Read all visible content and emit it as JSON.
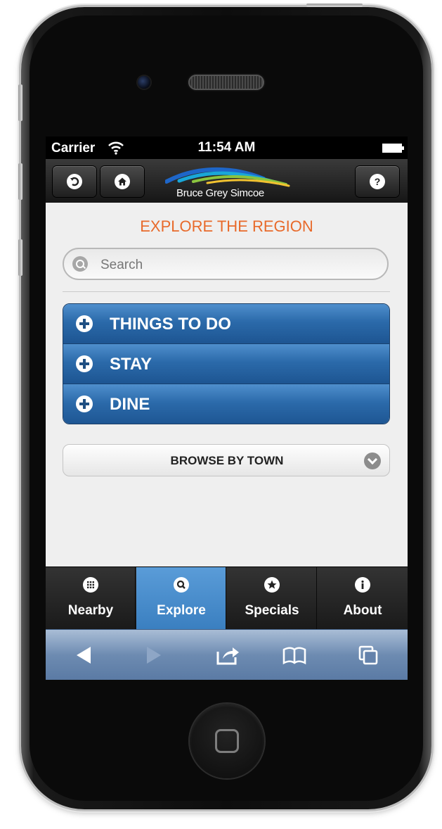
{
  "status": {
    "carrier": "Carrier",
    "time": "11:54 AM"
  },
  "header": {
    "logo_text": "Bruce Grey Simcoe",
    "help_label": "?"
  },
  "page": {
    "title": "EXPLORE THE REGION"
  },
  "search": {
    "placeholder": "Search"
  },
  "menu": {
    "items": [
      {
        "label": "THINGS TO DO"
      },
      {
        "label": "STAY"
      },
      {
        "label": "DINE"
      }
    ]
  },
  "browse": {
    "label": "BROWSE BY TOWN"
  },
  "tabs": [
    {
      "label": "Nearby",
      "icon": "grid-icon",
      "active": false
    },
    {
      "label": "Explore",
      "icon": "search-icon",
      "active": true
    },
    {
      "label": "Specials",
      "icon": "star-icon",
      "active": false
    },
    {
      "label": "About",
      "icon": "info-icon",
      "active": false
    }
  ],
  "colors": {
    "accent": "#e86a2b",
    "menu_blue": "#2b6aaa",
    "tab_active": "#4a8ecc"
  }
}
